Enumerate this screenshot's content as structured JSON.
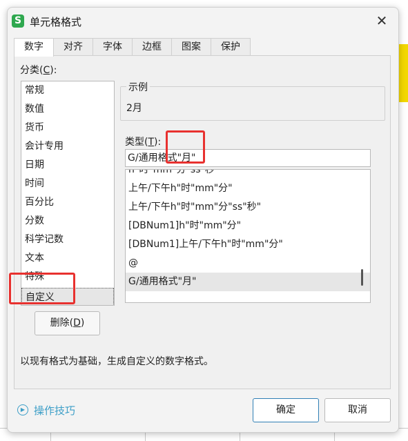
{
  "window": {
    "title": "单元格格式",
    "icon_letter": "S",
    "close_glyph": "✕"
  },
  "tabs": [
    {
      "label": "数字",
      "active": true
    },
    {
      "label": "对齐",
      "active": false
    },
    {
      "label": "字体",
      "active": false
    },
    {
      "label": "边框",
      "active": false
    },
    {
      "label": "图案",
      "active": false
    },
    {
      "label": "保护",
      "active": false
    }
  ],
  "category": {
    "label_prefix": "分类(",
    "label_key": "C",
    "label_suffix": "):",
    "items": [
      "常规",
      "数值",
      "货币",
      "会计专用",
      "日期",
      "时间",
      "百分比",
      "分数",
      "科学记数",
      "文本",
      "特殊",
      "自定义"
    ],
    "selected": "自定义"
  },
  "delete_button": {
    "label_prefix": "删除(",
    "label_key": "D",
    "label_suffix": ")"
  },
  "sample": {
    "legend": "示例",
    "value": "2月"
  },
  "type_field": {
    "label_prefix": "类型(",
    "label_key": "T",
    "label_suffix": "):",
    "value": "G/通用格式\"月\""
  },
  "type_list": {
    "items": [
      "h\"时\"mm\"分\"ss\"秒\"",
      "上午/下午h\"时\"mm\"分\"",
      "上午/下午h\"时\"mm\"分\"ss\"秒\"",
      "[DBNum1]h\"时\"mm\"分\"",
      "[DBNum1]上午/下午h\"时\"mm\"分\"",
      "@",
      "G/通用格式\"月\""
    ],
    "selected": "G/通用格式\"月\""
  },
  "description": "以现有格式为基础，生成自定义的数字格式。",
  "footer": {
    "tips_label": "操作技巧",
    "tips_icon": "play-circle-icon",
    "ok_label": "确定",
    "cancel_label": "取消"
  },
  "colors": {
    "accent": "#2f7fb5",
    "link": "#3c9ec7",
    "annotation": "#e8312f",
    "brand": "#2fa84f"
  }
}
